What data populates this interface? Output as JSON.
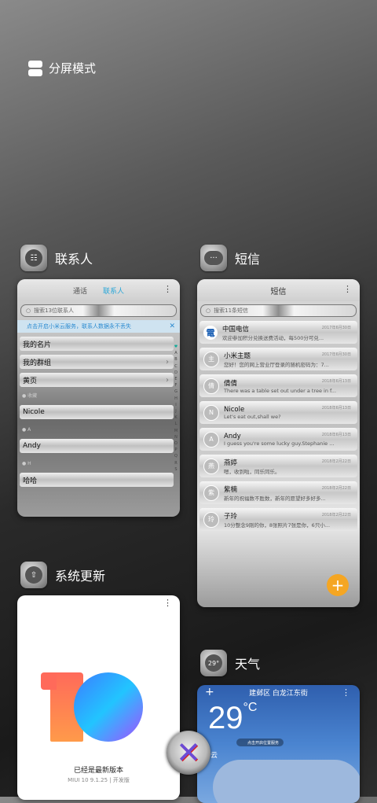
{
  "split_mode": {
    "label": "分屏模式",
    "icon": "split-screen-icon"
  },
  "apps": {
    "contacts": {
      "name": "联系人",
      "icon": "contacts-icon",
      "tabs": [
        "通话",
        "联系人"
      ],
      "search_placeholder": "搜索13位联系人",
      "notice": "点击开启小米云服务，联系人数据永不丢失",
      "rows": [
        "我的名片",
        "我的群组",
        "黄页"
      ],
      "sections": [
        "收藏",
        "A",
        "H"
      ],
      "contacts": [
        "Nicole",
        "Andy",
        "哈哈"
      ],
      "alphabet": [
        "♥",
        "A",
        "B",
        "C",
        "D",
        "E",
        "F",
        "G",
        "H",
        "I",
        "J",
        "K",
        "L",
        "M",
        "N",
        "O",
        "P",
        "Q",
        "R",
        "S"
      ]
    },
    "sms": {
      "name": "短信",
      "icon": "sms-icon",
      "title": "短信",
      "search_placeholder": "搜索11条短信",
      "messages": [
        {
          "avatar": "電",
          "name": "中国电信",
          "body": "欢迎参加积分兑换送费活动，每500分可兑...",
          "date": "2017年6月30日"
        },
        {
          "avatar": "主",
          "name": "小米主题",
          "body": "您好！您的网上营业厅登录的随机密码为：7...",
          "date": "2017年6月30日"
        },
        {
          "avatar": "倩",
          "name": "倩倩",
          "body": "There was a table set out under a tree in f...",
          "date": "2018年6月13日"
        },
        {
          "avatar": "N",
          "name": "Nicole",
          "body": "Let's eat out,shall we?",
          "date": "2018年6月13日"
        },
        {
          "avatar": "A",
          "name": "Andy",
          "body": "I guess you're some lucky guy.Stephanie ...",
          "date": "2018年6月13日"
        },
        {
          "avatar": "燕",
          "name": "燕婷",
          "body": "嗯，收到啦，同乐同乐。",
          "date": "2018年2月22日"
        },
        {
          "avatar": "紫",
          "name": "紫楠",
          "body": "新年的祝福数不胜数，新年的愿望好多好多...",
          "date": "2018年2月22日"
        },
        {
          "avatar": "玲",
          "name": "子玲",
          "body": "10分整念9刚的你，8张照片7张是你，6只小...",
          "date": "2018年2月22日"
        }
      ]
    },
    "update": {
      "name": "系统更新",
      "icon": "system-update-icon",
      "status": "已经是最新版本",
      "version": "MIUI 10 9.1.25 | 开发版"
    },
    "weather": {
      "name": "天气",
      "icon": "weather-icon",
      "icon_text": "29°",
      "location": "建邺区 白龙江东街",
      "temperature": "29",
      "degree": "°C",
      "condition": "多云",
      "badge": "点击开启位置服务"
    }
  },
  "close_button": {
    "glyph": "✕",
    "icon": "close-all-icon"
  }
}
